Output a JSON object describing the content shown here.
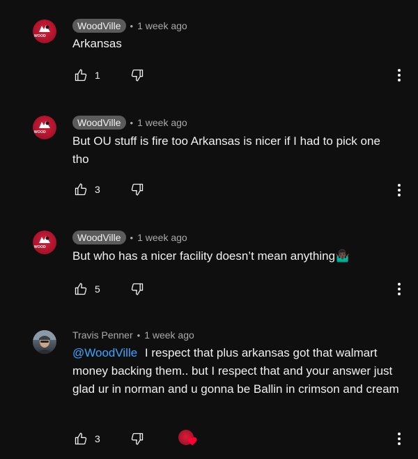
{
  "comments": [
    {
      "author": "WoodVille",
      "author_style": "chip",
      "separator": "•",
      "time": "1 week ago",
      "mention": "",
      "text": "Arkansas",
      "likes": "1",
      "avatar_label": "WOOD"
    },
    {
      "author": "WoodVille",
      "author_style": "chip",
      "separator": "•",
      "time": "1 week ago",
      "mention": "",
      "text": "But OU stuff is fire too Arkansas is nicer if I had to pick one tho",
      "likes": "3",
      "avatar_label": "WOOD"
    },
    {
      "author": "WoodVille",
      "author_style": "chip",
      "separator": "•",
      "time": "1 week ago",
      "mention": "",
      "text": "But who has a nicer facility doesn’t mean anything🤷🏿‍♂️",
      "likes": "5",
      "avatar_label": "WOOD"
    },
    {
      "author": "Travis Penner",
      "author_style": "plain",
      "separator": "•",
      "time": "1 week ago",
      "mention": "@WoodVille",
      "text": "I respect that plus arkansas got that walmart money backing them.. but I respect that and your answer just glad ur in norman and u gonna be Ballin in crimson and cream",
      "likes": "3",
      "creator_hearted": true
    }
  ],
  "colors": {
    "background": "#0f0f0f",
    "text": "#f1f1f1",
    "secondary_text": "#aaaaaa",
    "author_chip": "#5b5b5b",
    "mention": "#3ea6ff",
    "heart": "#ff0033",
    "brand_red": "#c4162e"
  },
  "icons": {
    "like": "thumbs-up-icon",
    "dislike": "thumbs-down-icon",
    "more": "vertical-dots-icon",
    "heart": "heart-icon"
  }
}
